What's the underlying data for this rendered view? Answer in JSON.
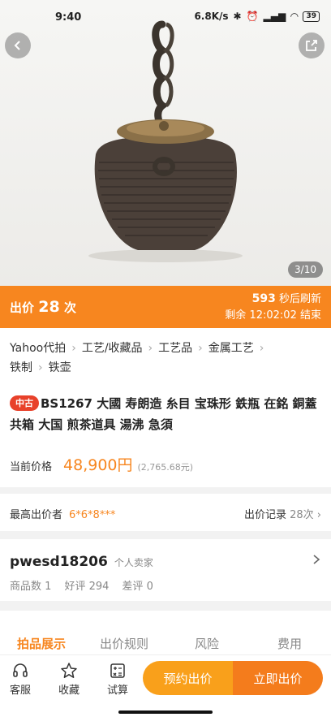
{
  "status_bar": {
    "time": "9:40",
    "network": "6.8K/s",
    "battery": "39"
  },
  "gallery": {
    "counter": "3/10"
  },
  "bid_bar": {
    "label": "出价",
    "count": "28",
    "unit": "次",
    "refresh_seconds": "593",
    "refresh_text": "秒后刷新",
    "remaining_label": "剩余",
    "remaining_time": "12:02:02",
    "end_text": "结束"
  },
  "breadcrumb": [
    "Yahoo代拍",
    "工艺/收藏品",
    "工艺品",
    "金属工艺",
    "铁制",
    "铁壶"
  ],
  "item": {
    "condition_tag": "中古",
    "title": "BS1267 大國 寿朗造 糸目 宝珠形 鉄瓶 在銘 銅蓋 共箱 大国 煎茶道具 湯沸 急須",
    "price_label": "当前价格",
    "price": "48,900円",
    "price_cny": "(2,765.68元)"
  },
  "bidder": {
    "label": "最高出价者",
    "name": "6*6*8***",
    "history_label": "出价记录",
    "history_count": "28次"
  },
  "seller": {
    "name": "pwesd18206",
    "type": "个人卖家",
    "items_label": "商品数",
    "items_count": "1",
    "good_label": "好评",
    "good_count": "294",
    "bad_label": "差评",
    "bad_count": "0"
  },
  "tabs": [
    "拍品展示",
    "出价规则",
    "风险",
    "费用"
  ],
  "bottom": {
    "service": "客服",
    "favorite": "收藏",
    "calculator": "试算",
    "reserve_bid": "预约出价",
    "bid_now": "立即出价"
  },
  "colors": {
    "accent": "#f7861f",
    "tag_red": "#e8412a",
    "reserve": "#f9a01b"
  }
}
